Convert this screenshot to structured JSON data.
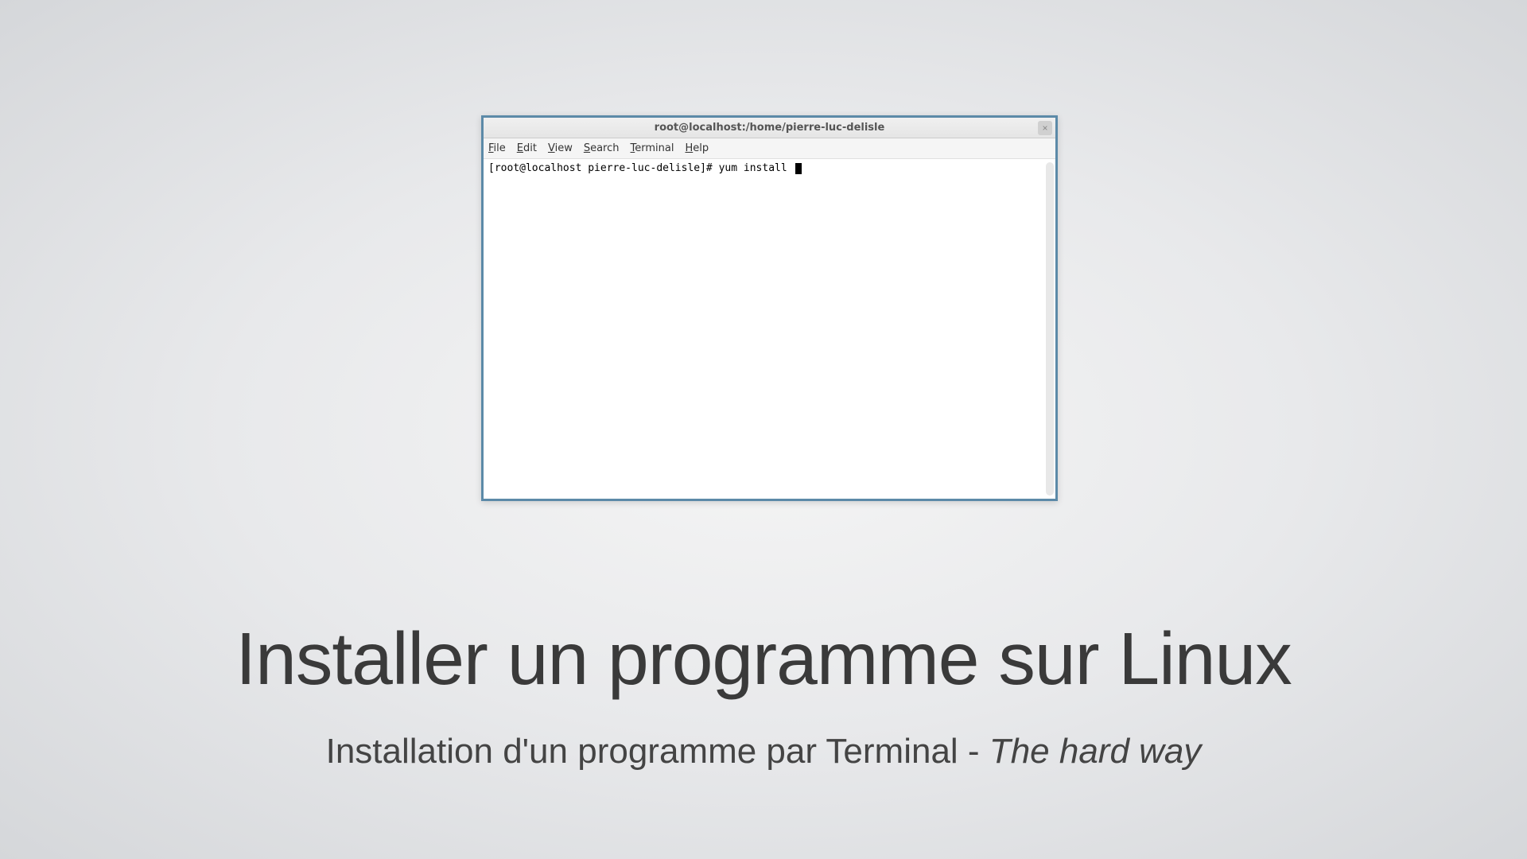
{
  "slide": {
    "title": "Installer un programme sur Linux",
    "subtitle_prefix": "Installation d'un programme par Terminal - ",
    "subtitle_italic": "The hard way"
  },
  "terminal": {
    "window_title": "root@localhost:/home/pierre-luc-delisle",
    "menus": {
      "file": "File",
      "edit": "Edit",
      "view": "View",
      "search": "Search",
      "terminal": "Terminal",
      "help": "Help"
    },
    "prompt": "[root@localhost pierre-luc-delisle]# ",
    "command": "yum install ",
    "close_icon": "×"
  }
}
